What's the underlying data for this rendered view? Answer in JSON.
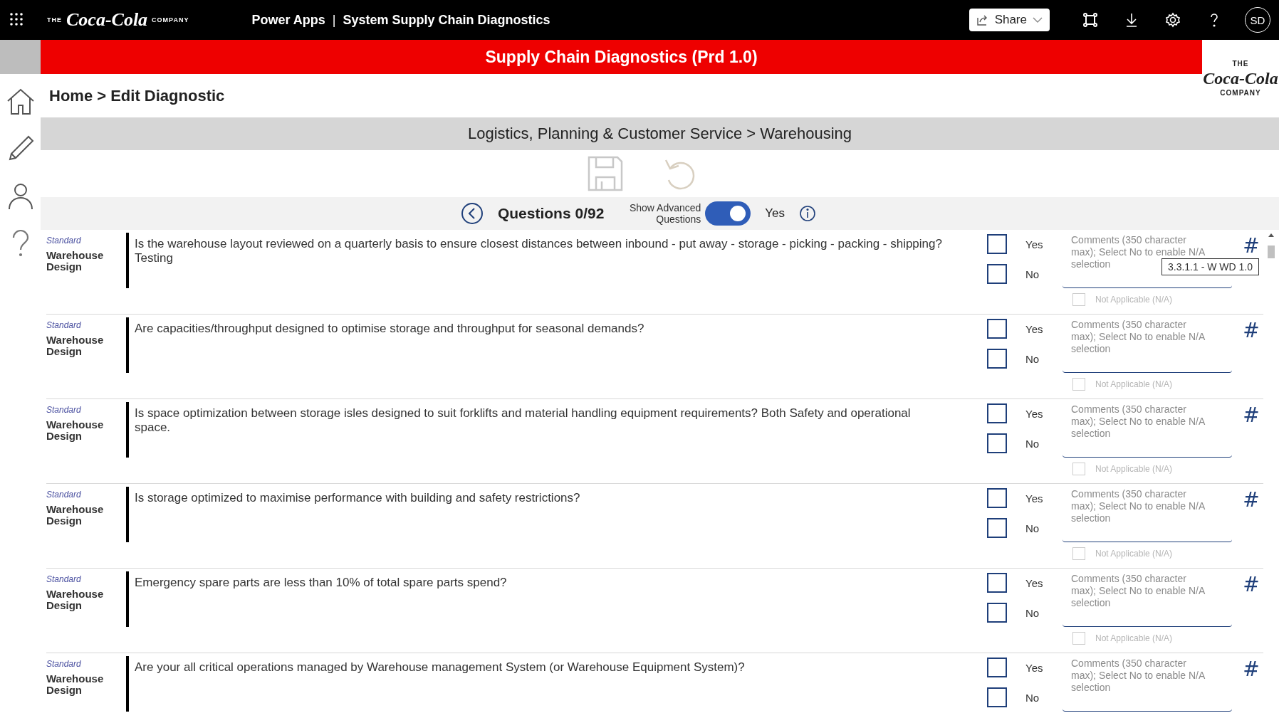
{
  "top_bar": {
    "brand_the": "THE",
    "brand_script": "Coca-Cola",
    "brand_company": "COMPANY",
    "app_name": "Power Apps",
    "separator": "|",
    "app_title": "System Supply Chain Diagnostics",
    "share": "Share",
    "avatar": "SD"
  },
  "banner": {
    "title": "Supply Chain Diagnostics (Prd 1.0)"
  },
  "logo": {
    "the": "THE",
    "script": "Coca-Cola",
    "company": "COMPANY"
  },
  "breadcrumb": "Home > Edit Diagnostic",
  "section_title": "Logistics, Planning & Customer Service > Warehousing",
  "toolbar": {
    "save_disabled": true,
    "undo_disabled": true
  },
  "questions_bar": {
    "counter": "Questions 0/92",
    "advanced_label": "Show Advanced Questions",
    "advanced_on": true,
    "advanced_value": "Yes"
  },
  "rows": [
    {
      "tag": "Standard",
      "category": "Warehouse Design",
      "question": "Is the warehouse layout reviewed on a quarterly basis to ensure closest distances between inbound - put away - storage - picking - packing - shipping?Testing",
      "yes": {
        "label": "Yes",
        "checked": false
      },
      "no": {
        "label": "No",
        "checked": false
      },
      "comment_placeholder": "Comments (350 character max); Select No to enable N/A selection",
      "na": {
        "label": "Not Applicable (N/A)",
        "checked": false,
        "disabled": true
      },
      "hash": "#",
      "tooltip": "3.3.1.1 - W WD 1.0"
    },
    {
      "tag": "Standard",
      "category": "Warehouse Design",
      "question": "Are capacities/throughput designed to optimise storage and throughput for seasonal demands?",
      "yes": {
        "label": "Yes",
        "checked": false
      },
      "no": {
        "label": "No",
        "checked": false
      },
      "comment_placeholder": "Comments (350 character max); Select No to enable N/A selection",
      "na": {
        "label": "Not Applicable (N/A)",
        "checked": false,
        "disabled": true
      },
      "hash": "#"
    },
    {
      "tag": "Standard",
      "category": "Warehouse Design",
      "question": "Is space optimization between storage isles designed to suit forklifts and material handling equipment requirements? Both Safety and operational space.",
      "yes": {
        "label": "Yes",
        "checked": false
      },
      "no": {
        "label": "No",
        "checked": false
      },
      "comment_placeholder": "Comments (350 character max); Select No to enable N/A selection",
      "na": {
        "label": "Not Applicable (N/A)",
        "checked": false,
        "disabled": true
      },
      "hash": "#"
    },
    {
      "tag": "Standard",
      "category": "Warehouse Design",
      "question": "Is storage optimized to maximise performance with building and safety restrictions?",
      "yes": {
        "label": "Yes",
        "checked": false
      },
      "no": {
        "label": "No",
        "checked": false
      },
      "comment_placeholder": "Comments (350 character max); Select No to enable N/A selection",
      "na": {
        "label": "Not Applicable (N/A)",
        "checked": false,
        "disabled": true
      },
      "hash": "#"
    },
    {
      "tag": "Standard",
      "category": "Warehouse Design",
      "question": "Emergency spare parts are less than 10% of total spare parts spend?",
      "yes": {
        "label": "Yes",
        "checked": false
      },
      "no": {
        "label": "No",
        "checked": false
      },
      "comment_placeholder": "Comments (350 character max); Select No to enable N/A selection",
      "na": {
        "label": "Not Applicable (N/A)",
        "checked": false,
        "disabled": true
      },
      "hash": "#"
    },
    {
      "tag": "Standard",
      "category": "Warehouse Design",
      "question": "Are your all critical operations managed by Warehouse management System (or Warehouse Equipment System)?",
      "yes": {
        "label": "Yes",
        "checked": false
      },
      "no": {
        "label": "No",
        "checked": false
      },
      "comment_placeholder": "Comments (350 character max); Select No to enable N/A selection",
      "hash": "#"
    }
  ]
}
